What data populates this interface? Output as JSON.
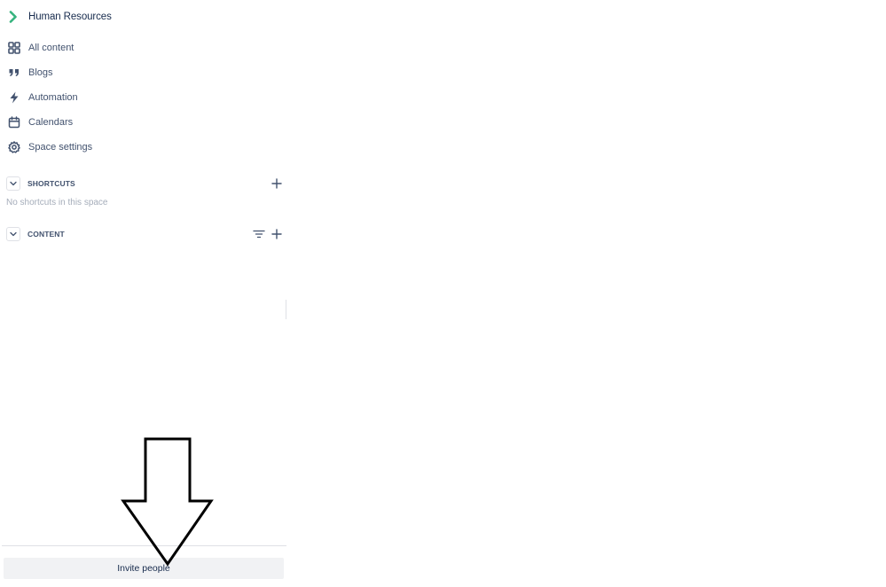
{
  "sidebar": {
    "space_name": "Human Resources",
    "space_icon": "chevron-right-icon",
    "nav_items": [
      {
        "label": "All content",
        "icon": "grid-icon"
      },
      {
        "label": "Blogs",
        "icon": "quote-icon"
      },
      {
        "label": "Automation",
        "icon": "lightning-icon"
      },
      {
        "label": "Calendars",
        "icon": "calendar-icon"
      },
      {
        "label": "Space settings",
        "icon": "gear-icon"
      }
    ],
    "shortcuts": {
      "title": "SHORTCUTS",
      "empty_text": "No shortcuts in this space"
    },
    "content": {
      "title": "CONTENT"
    },
    "invite_label": "Invite people"
  },
  "colors": {
    "space_icon": "#36b37e",
    "text_primary": "#172b4d",
    "text_secondary": "#42526e",
    "text_muted": "#a5adba",
    "button_bg": "#f1f2f4"
  },
  "annotation": {
    "shape": "down-arrow-outline",
    "color": "#000000"
  }
}
